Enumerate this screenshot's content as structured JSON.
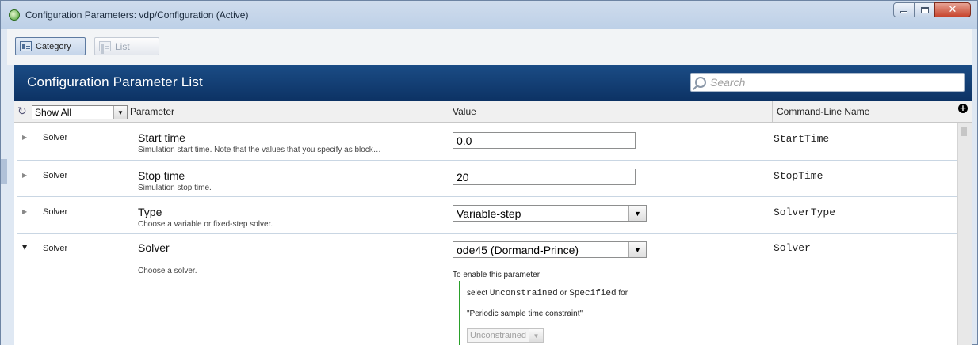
{
  "window": {
    "title": "Configuration Parameters: vdp/Configuration (Active)",
    "buttons": [
      "minimize",
      "maximize",
      "close"
    ]
  },
  "toolbar": {
    "category_label": "Category",
    "list_label": "List"
  },
  "panel": {
    "title": "Configuration Parameter List",
    "search_placeholder": "Search"
  },
  "grid": {
    "filter_value": "Show All",
    "columns": {
      "parameter": "Parameter",
      "value": "Value",
      "command_line": "Command-Line Name"
    }
  },
  "rows": [
    {
      "category": "Solver",
      "name": "Start time",
      "description": "Simulation start time. Note that the values that you specify as block…",
      "value": "0.0",
      "command": "StartTime",
      "expanded": false
    },
    {
      "category": "Solver",
      "name": "Stop time",
      "description": "Simulation stop time.",
      "value": "20",
      "command": "StopTime",
      "expanded": false
    },
    {
      "category": "Solver",
      "name": "Type",
      "description": "Choose a variable or fixed-step solver.",
      "value": "Variable-step",
      "command": "SolverType",
      "expanded": false
    },
    {
      "category": "Solver",
      "name": "Solver",
      "description": "Choose a solver.",
      "value": "ode45 (Dormand-Prince)",
      "command": "Solver",
      "expanded": true
    }
  ],
  "dependency": {
    "heading": "To enable this parameter",
    "line1_prefix": "select ",
    "option1": "Unconstrained",
    "line1_or": " or ",
    "option2": "Specified",
    "line1_suffix": " for",
    "line2": "\"Periodic sample time constraint\"",
    "disabled_value": "Unconstrained"
  },
  "colors": {
    "header_blue": "#0c3264",
    "dependency_green": "#2aa02a"
  },
  "icons": [
    "app-icon",
    "category-icon",
    "list-icon",
    "search-icon",
    "refresh-icon",
    "add-column-icon",
    "expand-arrow-icon",
    "collapse-arrow-icon",
    "dropdown-arrow-icon"
  ]
}
